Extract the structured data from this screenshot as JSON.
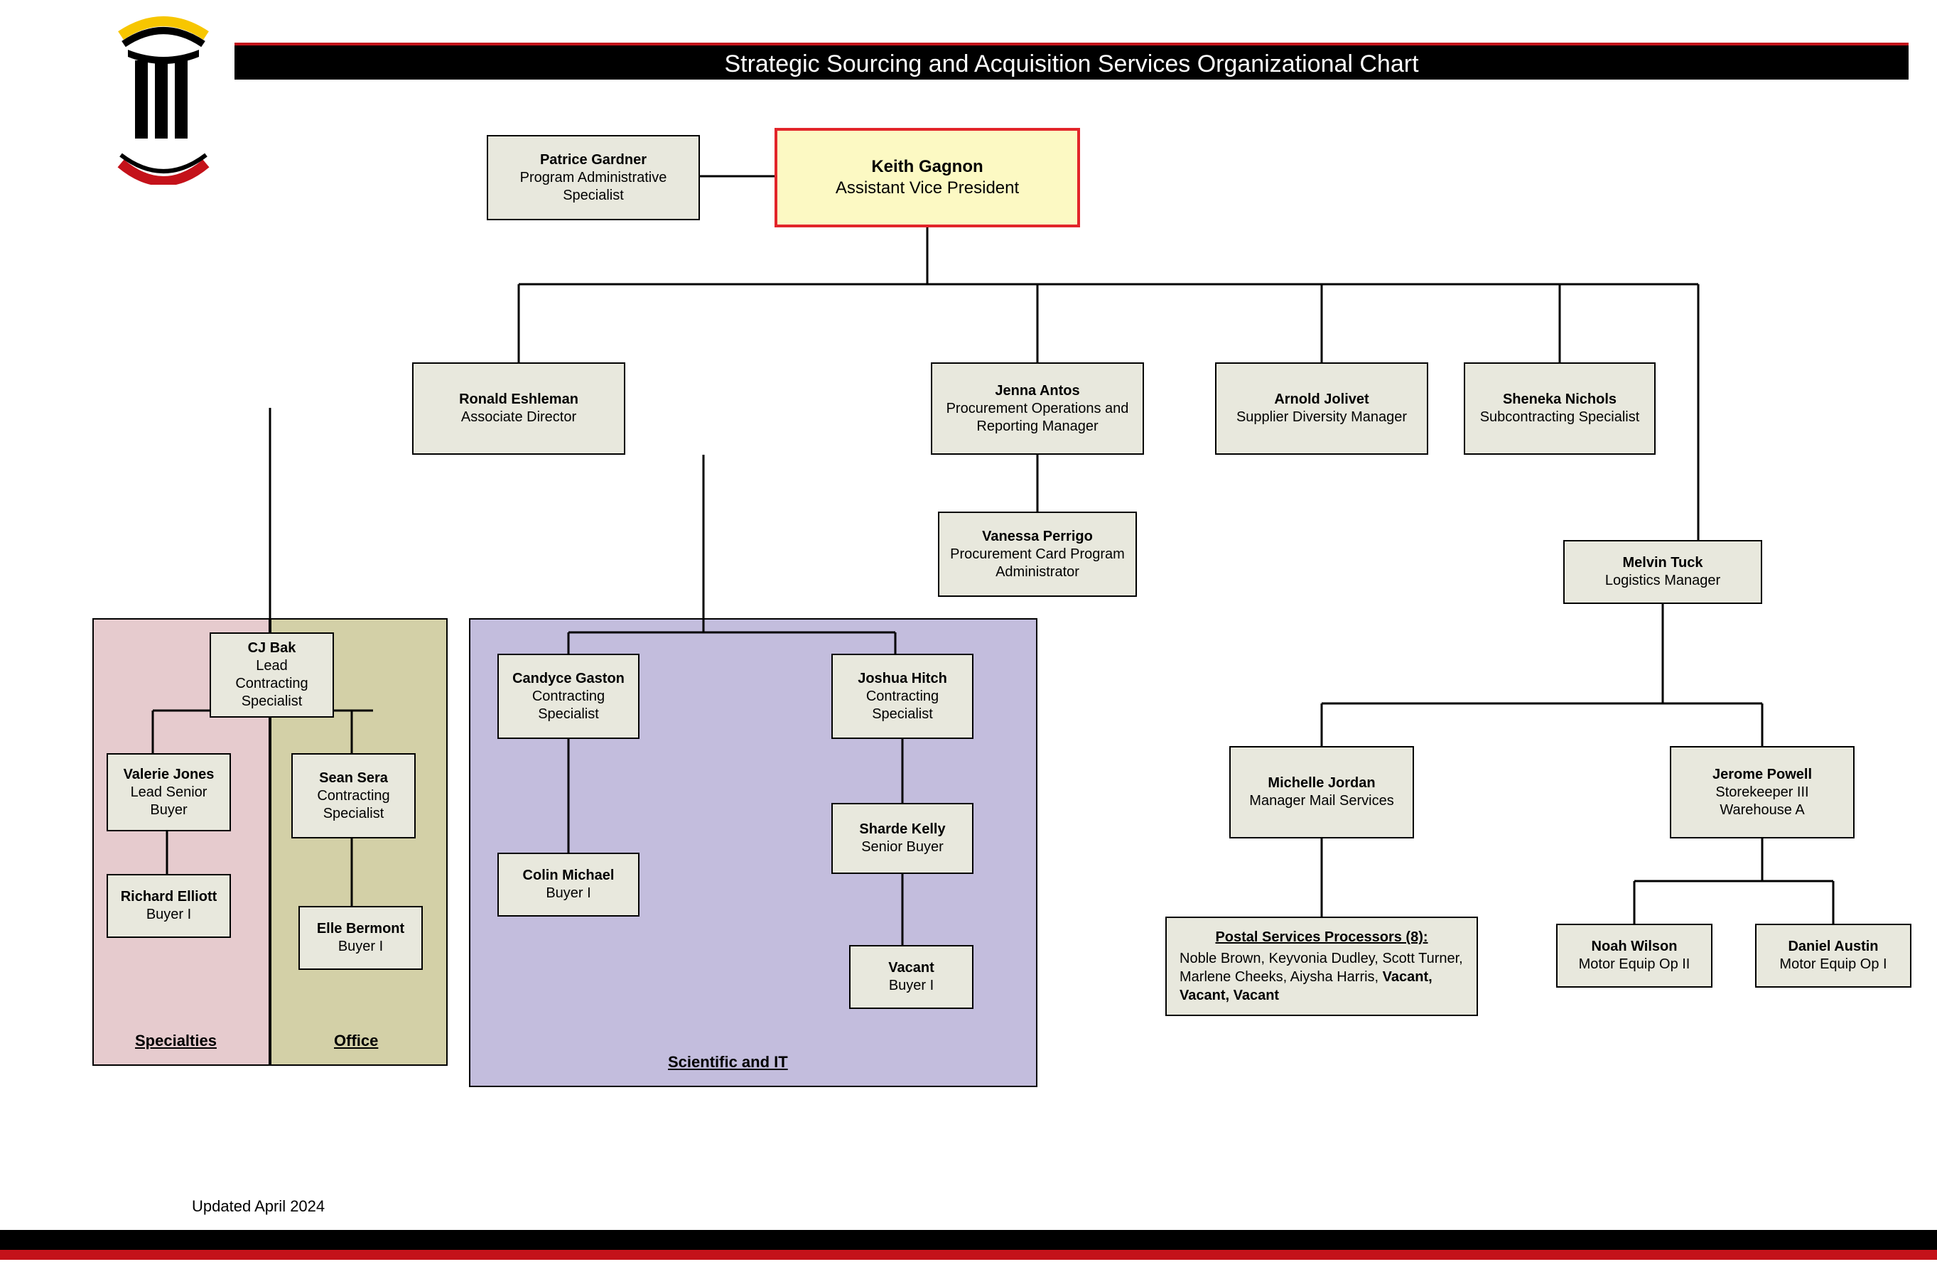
{
  "title": "Strategic Sourcing and Acquisition Services Organizational Chart",
  "updated": "Updated April 2024",
  "groups": {
    "specialties": "Specialties",
    "office": "Office",
    "scientific": "Scientific and IT"
  },
  "nodes": {
    "keith": {
      "name": "Keith Gagnon",
      "title": "Assistant Vice President"
    },
    "patrice": {
      "name": "Patrice Gardner",
      "title": "Program Administrative Specialist"
    },
    "ronald": {
      "name": "Ronald Eshleman",
      "title": "Associate Director"
    },
    "jenna": {
      "name": "Jenna Antos",
      "title": "Procurement Operations and Reporting Manager"
    },
    "arnold": {
      "name": "Arnold Jolivet",
      "title": "Supplier Diversity Manager"
    },
    "sheneka": {
      "name": "Sheneka Nichols",
      "title": "Subcontracting Specialist"
    },
    "vanessa": {
      "name": "Vanessa Perrigo",
      "title": "Procurement Card Program Administrator"
    },
    "melvin": {
      "name": "Melvin Tuck",
      "title": "Logistics Manager"
    },
    "cj": {
      "name": "CJ Bak",
      "title": "Lead Contracting Specialist"
    },
    "valerie": {
      "name": "Valerie Jones",
      "title": "Lead Senior Buyer"
    },
    "richard": {
      "name": "Richard Elliott",
      "title": "Buyer I"
    },
    "sean": {
      "name": "Sean Sera",
      "title": "Contracting Specialist"
    },
    "elle": {
      "name": "Elle Bermont",
      "title": "Buyer I"
    },
    "candyce": {
      "name": "Candyce Gaston",
      "title": "Contracting Specialist"
    },
    "colin": {
      "name": "Colin Michael",
      "title": "Buyer I"
    },
    "joshua": {
      "name": "Joshua Hitch",
      "title": "Contracting Specialist"
    },
    "sharde": {
      "name": "Sharde Kelly",
      "title": "Senior Buyer"
    },
    "vacant": {
      "name": "Vacant",
      "title": "Buyer I"
    },
    "michelle": {
      "name": "Michelle Jordan",
      "title": "Manager Mail Services"
    },
    "jerome": {
      "name": "Jerome Powell",
      "title": "Storekeeper III Warehouse A"
    },
    "noah": {
      "name": "Noah Wilson",
      "title": "Motor Equip Op II"
    },
    "daniel": {
      "name": "Daniel Austin",
      "title": "Motor Equip Op I"
    }
  },
  "postal": {
    "header": "Postal Services Processors (8):",
    "body": "Noble Brown,  Keyvonia Dudley, Scott Turner, Marlene Cheeks, Aiysha Harris, ",
    "vacant": "Vacant, Vacant, Vacant"
  }
}
